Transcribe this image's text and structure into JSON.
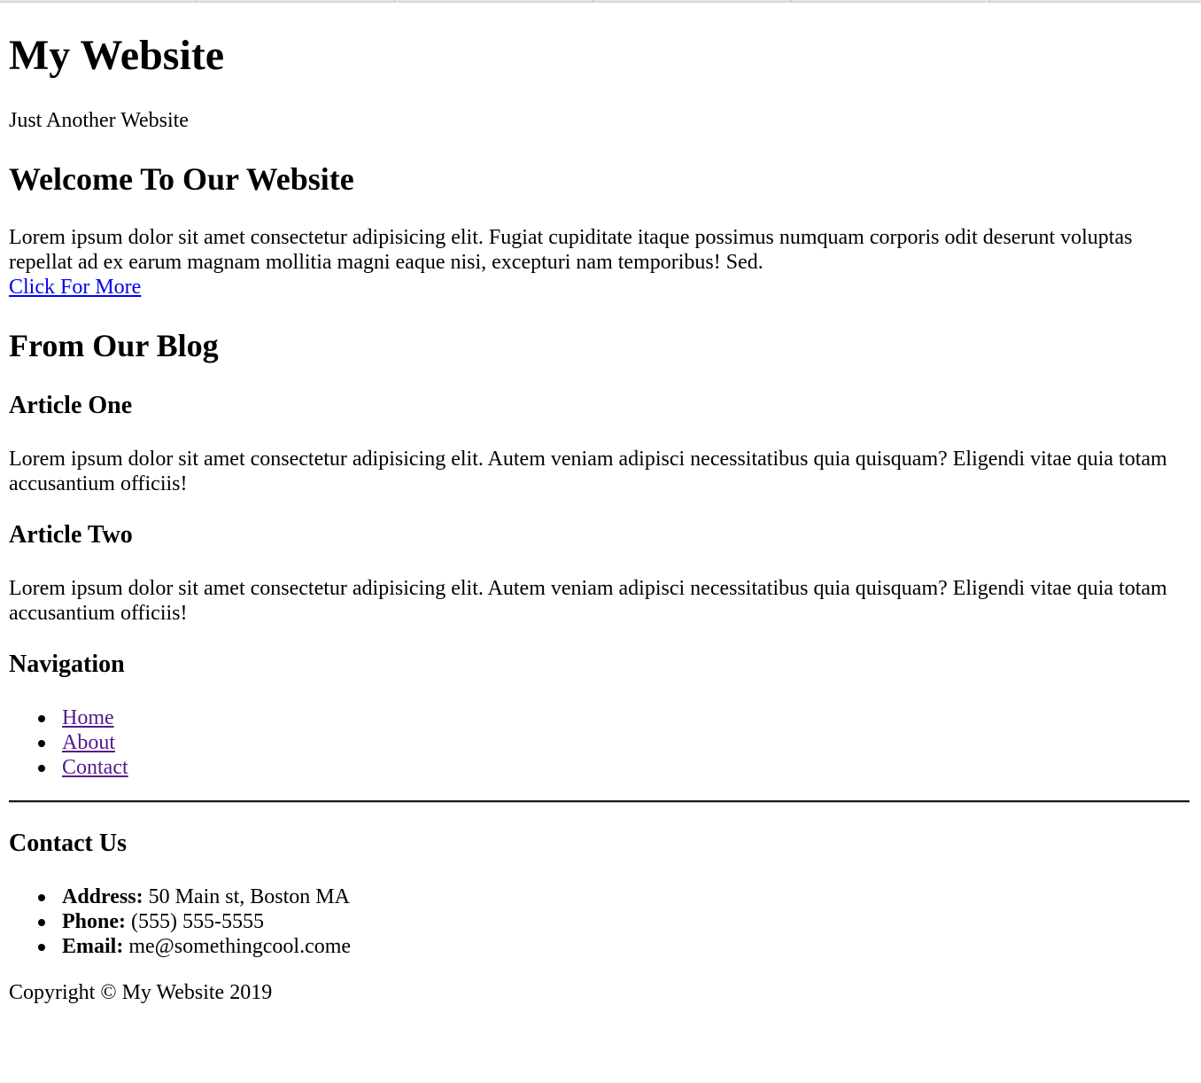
{
  "header": {
    "title": "My Website",
    "tagline": "Just Another Website"
  },
  "welcome": {
    "heading": "Welcome To Our Website",
    "body_line1": "Lorem ipsum dolor sit amet consectetur adipisicing elit. Fugiat cupiditate itaque possimus numquam corporis odit deserunt voluptas",
    "body_line2": "repellat ad ex earum magnam mollitia magni eaque nisi, excepturi nam temporibus! Sed.",
    "link_label": "Click For More"
  },
  "blog": {
    "heading": "From Our Blog",
    "articles": [
      {
        "title": "Article One",
        "body_line1": "Lorem ipsum dolor sit amet consectetur adipisicing elit. Autem veniam adipisci necessitatibus quia quisquam? Eligendi vitae quia totam",
        "body_line2": "accusantium officiis!"
      },
      {
        "title": "Article Two",
        "body_line1": "Lorem ipsum dolor sit amet consectetur adipisicing elit. Autem veniam adipisci necessitatibus quia quisquam? Eligendi vitae quia totam",
        "body_line2": "accusantium officiis!"
      }
    ]
  },
  "navigation": {
    "heading": "Navigation",
    "links": [
      "Home",
      "About",
      "Contact"
    ]
  },
  "contact": {
    "heading": "Contact Us",
    "items": [
      {
        "label": "Address:",
        "value": " 50 Main st, Boston MA"
      },
      {
        "label": "Phone:",
        "value": " (555) 555-5555"
      },
      {
        "label": "Email:",
        "value": " me@somethingcool.come"
      }
    ]
  },
  "footer": {
    "copyright": "Copyright © My Website 2019"
  },
  "colors": {
    "link": "#0000ee",
    "visited_link": "#551a8b",
    "text": "#000000",
    "background": "#ffffff"
  }
}
